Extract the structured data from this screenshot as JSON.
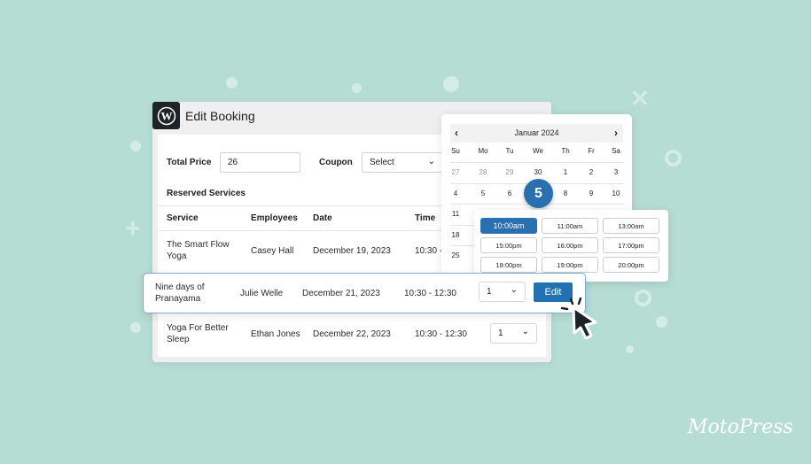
{
  "window": {
    "title": "Edit Booking",
    "logo": "wordpress-logo"
  },
  "form": {
    "total_price_label": "Total Price",
    "total_price_value": "26",
    "coupon_label": "Coupon",
    "coupon_value": "Select"
  },
  "section_title": "Reserved Services",
  "table": {
    "headers": [
      "Service",
      "Employees",
      "Date",
      "Time"
    ],
    "rows": [
      {
        "service": [
          "The Smart Flow",
          "Yoga"
        ],
        "employee": "Casey Hall",
        "date": "December 19, 2023",
        "time": "10:30 - 12:30"
      },
      {
        "service": [
          "Nine days of",
          "Pranayama"
        ],
        "employee": "Julie Welle",
        "date": "December 21, 2023",
        "time": "10:30 - 12:30",
        "quantity": "1",
        "action": "Edit"
      },
      {
        "service": [
          "Yoga For Better",
          "Sleep"
        ],
        "employee": "Ethan Jones",
        "date": "December 22, 2023",
        "time": "10:30 - 12:30",
        "quantity": "1"
      }
    ]
  },
  "calendar": {
    "month": "Januar 2024",
    "prev": "‹",
    "next": "›",
    "weekdays": [
      "Su",
      "Mo",
      "Tu",
      "We",
      "Th",
      "Fr",
      "Sa"
    ],
    "weeks": [
      [
        "27",
        "28",
        "29",
        "30",
        "1",
        "2",
        "3"
      ],
      [
        "4",
        "5",
        "6",
        "5",
        "8",
        "9",
        "10"
      ],
      [
        "11"
      ],
      [
        "18"
      ],
      [
        "25"
      ]
    ],
    "muted": [
      "27",
      "28",
      "29"
    ],
    "selected": "5"
  },
  "times": [
    "10:00am",
    "11:00am",
    "13:00am",
    "15:00pm",
    "16:00pm",
    "17:00pm",
    "18:00pm",
    "19:00pm",
    "20:00pm"
  ],
  "selected_time": "10:00am",
  "brand": "MotoPress",
  "colors": {
    "accent": "#2271b1",
    "background": "#b6ddd3"
  }
}
